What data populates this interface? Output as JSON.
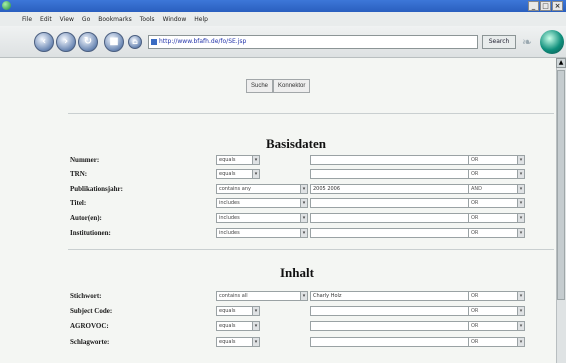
{
  "window": {
    "controls": [
      "_",
      "□",
      "×"
    ]
  },
  "menubar": [
    "File",
    "Edit",
    "View",
    "Go",
    "Bookmarks",
    "Tools",
    "Window",
    "Help"
  ],
  "navbar": {
    "url": "http://www.bfafh.de/fo/SE.jsp",
    "search_label": "Search"
  },
  "tabs": {
    "suche": "Suche",
    "konnektor": "Konnektor"
  },
  "sections": {
    "basisdaten": {
      "title": "Basisdaten",
      "rows": [
        {
          "label": "Nummer:",
          "operator": "equals",
          "value": "",
          "bool": "OR"
        },
        {
          "label": "TRN:",
          "operator": "equals",
          "value": "",
          "bool": "OR"
        },
        {
          "label": "Publikationsjahr:",
          "operator": "contains any",
          "value": "2005 2006",
          "bool": "AND"
        },
        {
          "label": "Titel:",
          "operator": "includes",
          "value": "",
          "bool": "OR"
        },
        {
          "label": "Autor(en):",
          "operator": "includes",
          "value": "",
          "bool": "OR"
        },
        {
          "label": "Institutionen:",
          "operator": "includes",
          "value": "",
          "bool": "OR"
        }
      ]
    },
    "inhalt": {
      "title": "Inhalt",
      "rows": [
        {
          "label": "Stichwort:",
          "operator": "contains all",
          "value": "Charly Holz",
          "bool": "OR"
        },
        {
          "label": "Subject Code:",
          "operator": "equals",
          "value": "",
          "bool": "OR"
        },
        {
          "label": "AGROVOC:",
          "operator": "equals",
          "value": "",
          "bool": "OR"
        },
        {
          "label": "Schlagworte:",
          "operator": "equals",
          "value": "",
          "bool": "OR"
        }
      ]
    }
  },
  "icons": {
    "back": "back-arrow-icon",
    "forward": "forward-arrow-icon",
    "reload": "reload-icon",
    "stop": "stop-icon",
    "home": "home-icon",
    "activity": "throbber-icon"
  }
}
